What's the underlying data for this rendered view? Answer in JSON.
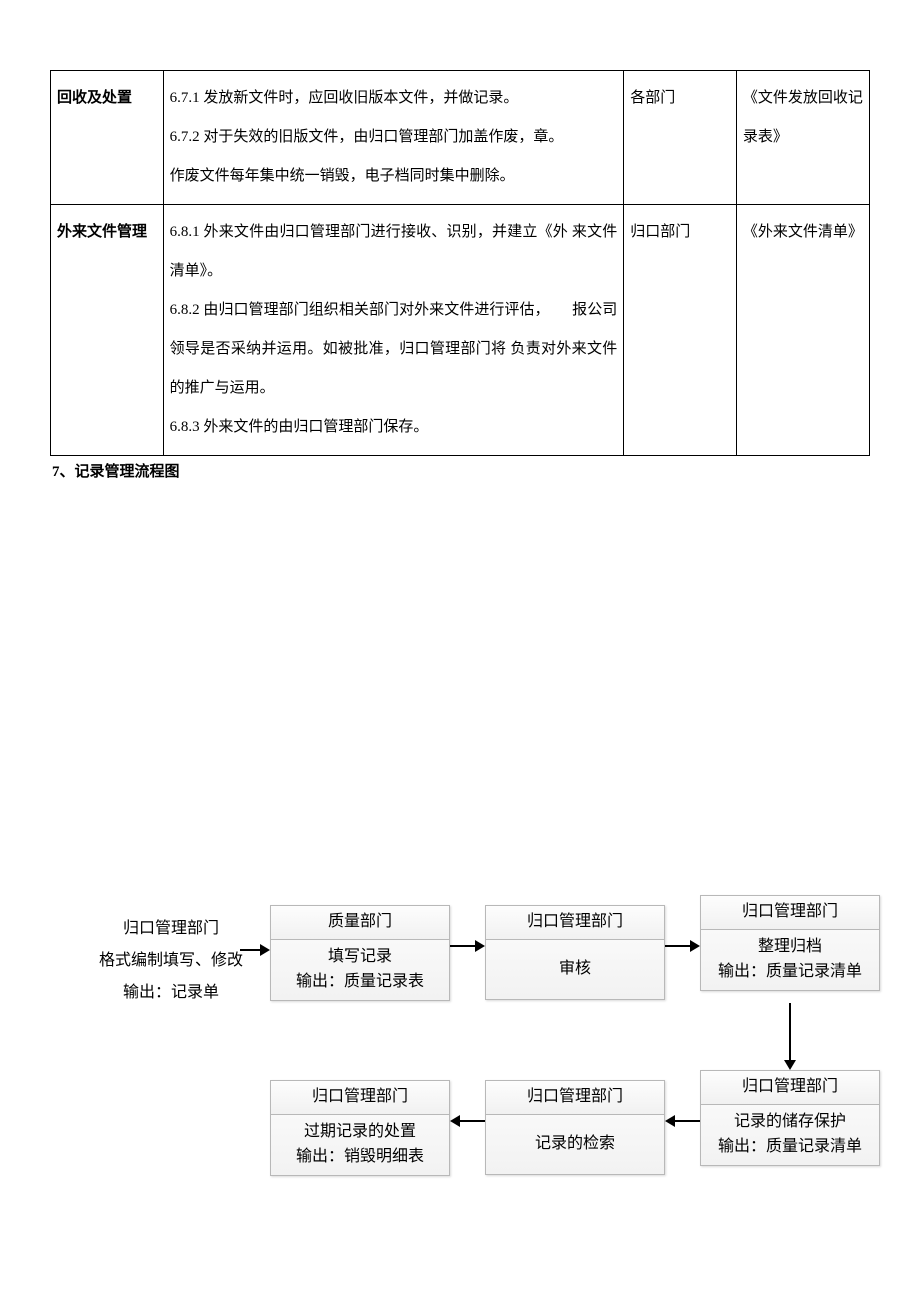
{
  "table": {
    "row1": {
      "c1": "回收及处置",
      "c2": "6.7.1 发放新文件时，应回收旧版本文件，并做记录。\n6.7.2 对于失效的旧版文件，由归口管理部门加盖作废，章。\n作废文件每年集中统一销毁，电子档同时集中删除。",
      "c3": "各部门",
      "c4": "《文件发放回收记录表》"
    },
    "row2": {
      "c1": "外来文件管理",
      "c2": "6.8.1 外来文件由归口管理部门进行接收、识别，并建立《外 来文件清单》。\n6.8.2 由归口管理部门组织相关部门对外来文件进行评估，　　报公司领导是否采纳并运用。如被批准，归口管理部门将 负责对外来文件的推广与运用。\n6.8.3 外来文件的由归口管理部门保存。",
      "c3": "归口部门",
      "c4": "《外来文件清单》"
    }
  },
  "section_title": "7、记录管理流程图",
  "intro": {
    "line1": "归口管理部门",
    "line2": "格式编制填写、修改",
    "line3": "输出：记录单"
  },
  "nodes": {
    "n1": {
      "head": "质量部门",
      "body": "填写记录\n输出：质量记录表"
    },
    "n2": {
      "head": "归口管理部门",
      "body": "审核"
    },
    "n3": {
      "head": "归口管理部门",
      "body": "整理归档\n输出：质量记录清单"
    },
    "n4": {
      "head": "归口管理部门",
      "body": "记录的储存保护\n输出：质量记录清单"
    },
    "n5": {
      "head": "归口管理部门",
      "body": "记录的检索"
    },
    "n6": {
      "head": "归口管理部门",
      "body": "过期记录的处置\n输出：销毁明细表"
    }
  }
}
